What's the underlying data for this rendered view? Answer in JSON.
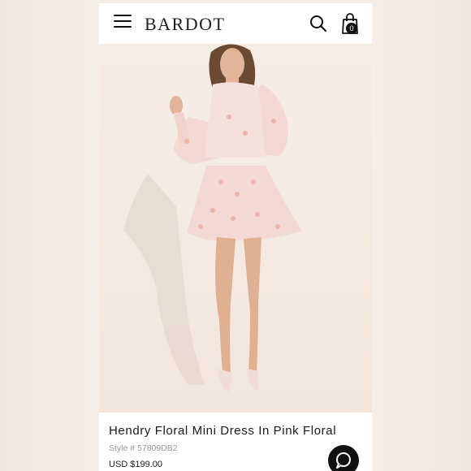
{
  "header": {
    "logo": "BARDOT",
    "cart_count": "0"
  },
  "icons": {
    "menu": "hamburger-icon",
    "search": "search-icon",
    "cart": "shopping-bag-icon",
    "chat": "chat-icon"
  },
  "carousel": {
    "slide_count": 6,
    "active_index": 0
  },
  "product": {
    "name": "Hendry Floral Mini Dress In Pink Floral",
    "style": "Style # 57809DB2",
    "price": "USD $199.00"
  },
  "colors": {
    "dress": "#f4d9d2",
    "accent": "#111111"
  }
}
